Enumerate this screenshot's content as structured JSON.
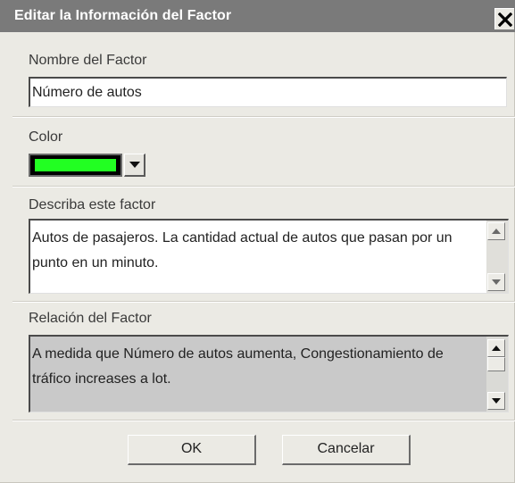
{
  "dialog": {
    "title": "Editar la Información del Factor",
    "close_label": "X"
  },
  "factor_name": {
    "label": "Nombre del Factor",
    "value": "Número de autos"
  },
  "color": {
    "label": "Color",
    "selected_hex": "#22ff22"
  },
  "description": {
    "label": "Describa este factor",
    "text": "Autos de pasajeros. La cantidad actual de autos que pasan por un punto en un minuto."
  },
  "relationship": {
    "label": "Relación del Factor",
    "text": "A medida que Número de autos aumenta, Congestionamiento de tráfico increases a lot."
  },
  "buttons": {
    "ok": "OK",
    "cancel": "Cancelar"
  },
  "colors": {
    "titlebar": "#7a7a7a",
    "dialog_bg": "#ebeae4",
    "readonly_bg": "#c9c9c9"
  }
}
